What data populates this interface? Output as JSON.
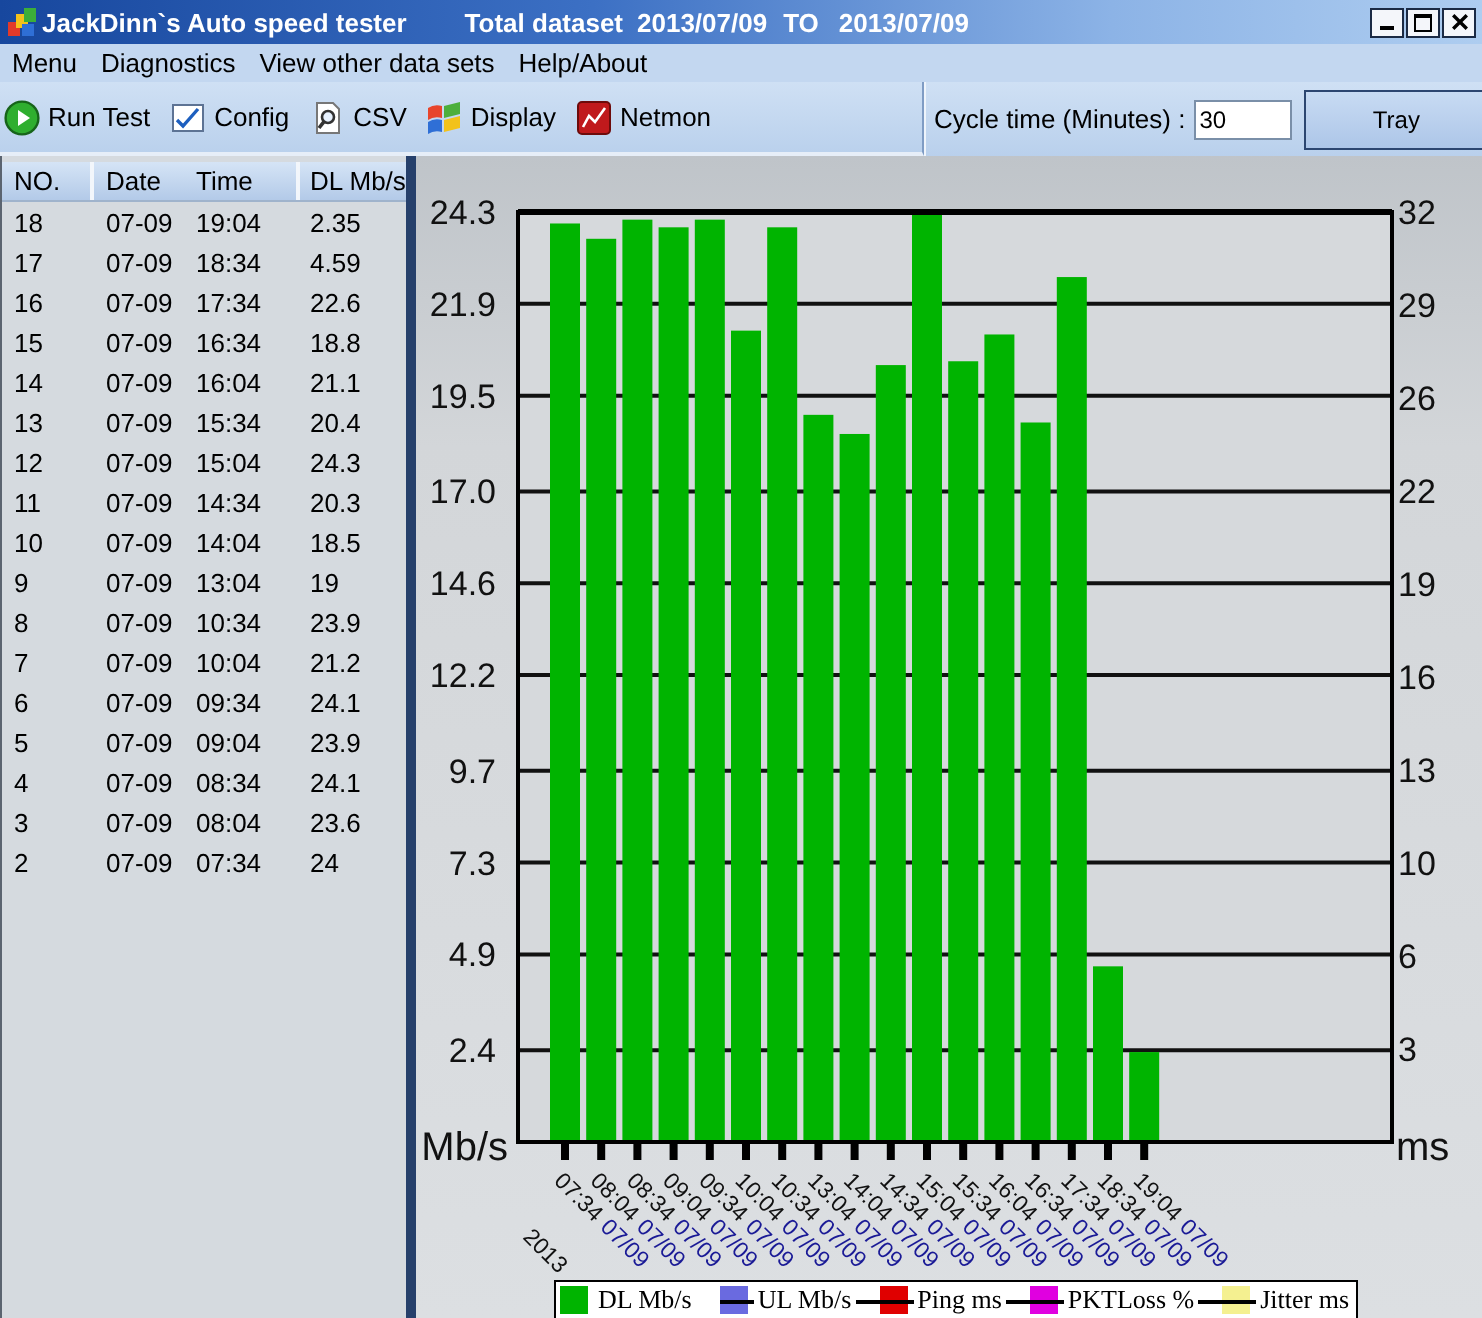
{
  "window": {
    "title": "JackDinn`s Auto speed tester",
    "dataset": "Total dataset",
    "date_from": "2013/07/09",
    "range_word": "TO",
    "date_to": "2013/07/09"
  },
  "menu": [
    "Menu",
    "Diagnostics",
    "View other data sets",
    "Help/About"
  ],
  "toolbar": {
    "buttons": [
      {
        "label": "Run Test",
        "kind": "run"
      },
      {
        "label": "Config",
        "kind": "config"
      },
      {
        "label": "CSV",
        "kind": "csv"
      },
      {
        "label": "Display",
        "kind": "display"
      },
      {
        "label": "Netmon",
        "kind": "netmon"
      }
    ],
    "cycle_time": {
      "label": "Cycle time (Minutes) :",
      "value": "30"
    },
    "tray_button": "Tray"
  },
  "table": {
    "columns": [
      "NO.",
      "Date",
      "Time",
      "DL Mb/s"
    ],
    "rows": [
      [
        "18",
        "07-09",
        "19:04",
        "2.35"
      ],
      [
        "17",
        "07-09",
        "18:34",
        "4.59"
      ],
      [
        "16",
        "07-09",
        "17:34",
        "22.6"
      ],
      [
        "15",
        "07-09",
        "16:34",
        "18.8"
      ],
      [
        "14",
        "07-09",
        "16:04",
        "21.1"
      ],
      [
        "13",
        "07-09",
        "15:34",
        "20.4"
      ],
      [
        "12",
        "07-09",
        "15:04",
        "24.3"
      ],
      [
        "11",
        "07-09",
        "14:34",
        "20.3"
      ],
      [
        "10",
        "07-09",
        "14:04",
        "18.5"
      ],
      [
        "9",
        "07-09",
        "13:04",
        "19"
      ],
      [
        "8",
        "07-09",
        "10:34",
        "23.9"
      ],
      [
        "7",
        "07-09",
        "10:04",
        "21.2"
      ],
      [
        "6",
        "07-09",
        "09:34",
        "24.1"
      ],
      [
        "5",
        "07-09",
        "09:04",
        "23.9"
      ],
      [
        "4",
        "07-09",
        "08:34",
        "24.1"
      ],
      [
        "3",
        "07-09",
        "08:04",
        "23.6"
      ],
      [
        "2",
        "07-09",
        "07:34",
        "24"
      ]
    ]
  },
  "chart": {
    "chart_data": {
      "type": "bar",
      "ylabel": "Mb/s",
      "grid": true,
      "categories": [
        "07:34 07/09",
        "08:04 07/09",
        "08:34 07/09",
        "09:04 07/09",
        "09:34 07/09",
        "10:04 07/09",
        "10:34 07/09",
        "13:04 07/09",
        "14:04 07/09",
        "14:34 07/09",
        "15:04 07/09",
        "15:34 07/09",
        "16:04 07/09",
        "16:34 07/09",
        "17:34 07/09",
        "18:34 07/09",
        "19:04 07/09"
      ],
      "values": [
        24,
        23.6,
        24.1,
        23.9,
        24.1,
        21.2,
        23.9,
        19,
        18.5,
        20.3,
        24.3,
        20.4,
        21.1,
        18.8,
        22.6,
        4.59,
        2.35
      ],
      "ylim": [
        0,
        24.3
      ],
      "yticks": [
        {
          "value": 2.4,
          "label": "2.4"
        },
        {
          "value": 4.9,
          "label": "4.9"
        },
        {
          "value": 7.3,
          "label": "7.3"
        },
        {
          "value": 9.7,
          "label": "9.7"
        },
        {
          "value": 12.2,
          "label": "12.2"
        },
        {
          "value": 14.6,
          "label": "14.6"
        },
        {
          "value": 17.0,
          "label": "17.0"
        },
        {
          "value": 19.5,
          "label": "19.5"
        },
        {
          "value": 21.9,
          "label": "21.9"
        },
        {
          "value": 24.3,
          "label": "24.3"
        }
      ]
    },
    "right_axis": {
      "label": "ms",
      "ticks": [
        "32",
        "29",
        "26",
        "22",
        "19",
        "16",
        "13",
        "10",
        "6",
        "3"
      ]
    },
    "year_label": "2013",
    "legend": [
      {
        "label": "DL Mb/s",
        "color": "#00b400",
        "visible": true
      },
      {
        "label": "UL Mb/s",
        "color": "#6a6ae0",
        "visible": false
      },
      {
        "label": "Ping ms",
        "color": "#e00000",
        "visible": false
      },
      {
        "label": "PKTLoss %",
        "color": "#e000e0",
        "visible": false
      },
      {
        "label": "Jitter ms",
        "color": "#f4f090",
        "visible": false
      }
    ]
  }
}
